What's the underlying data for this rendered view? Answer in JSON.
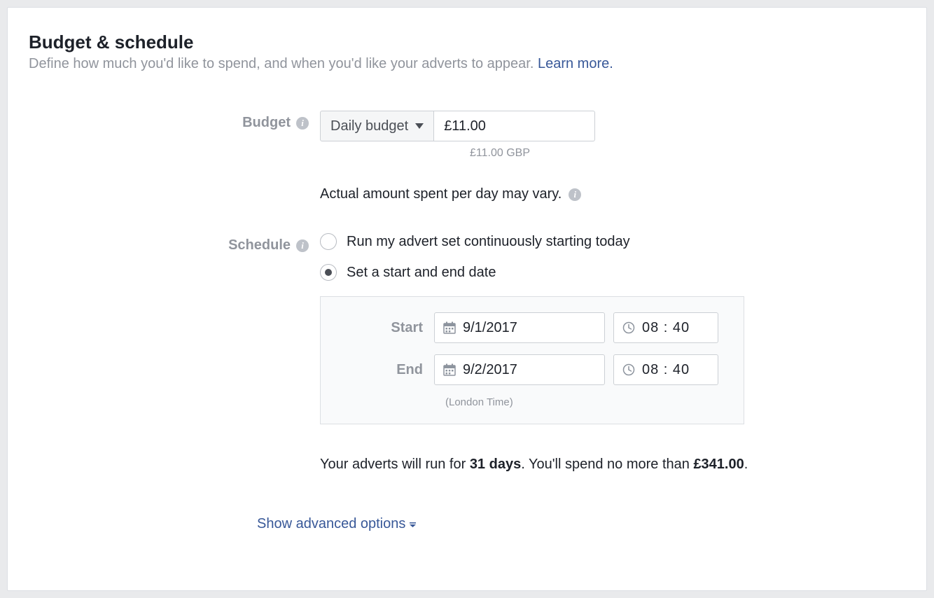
{
  "header": {
    "title": "Budget & schedule",
    "subtitle": "Define how much you'd like to spend, and when you'd like your adverts to appear. ",
    "learn_more": "Learn more."
  },
  "budget": {
    "label": "Budget",
    "type_selected": "Daily budget",
    "amount": "£11.00",
    "amount_subtext": "£11.00 GBP",
    "help_text": "Actual amount spent per day may vary."
  },
  "schedule": {
    "label": "Schedule",
    "options": [
      {
        "label": "Run my advert set continuously starting today",
        "selected": false
      },
      {
        "label": "Set a start and end date",
        "selected": true
      }
    ],
    "start_label": "Start",
    "end_label": "End",
    "start_date": "9/1/2017",
    "start_time": "08 : 40",
    "end_date": "9/2/2017",
    "end_time": "08 : 40",
    "timezone_note": "(London Time)"
  },
  "summary": {
    "part1": "Your adverts will run for ",
    "duration": "31 days",
    "part2": ". You'll spend no more than ",
    "total": "£341.00",
    "part3": "."
  },
  "advanced": {
    "label": "Show advanced options"
  }
}
